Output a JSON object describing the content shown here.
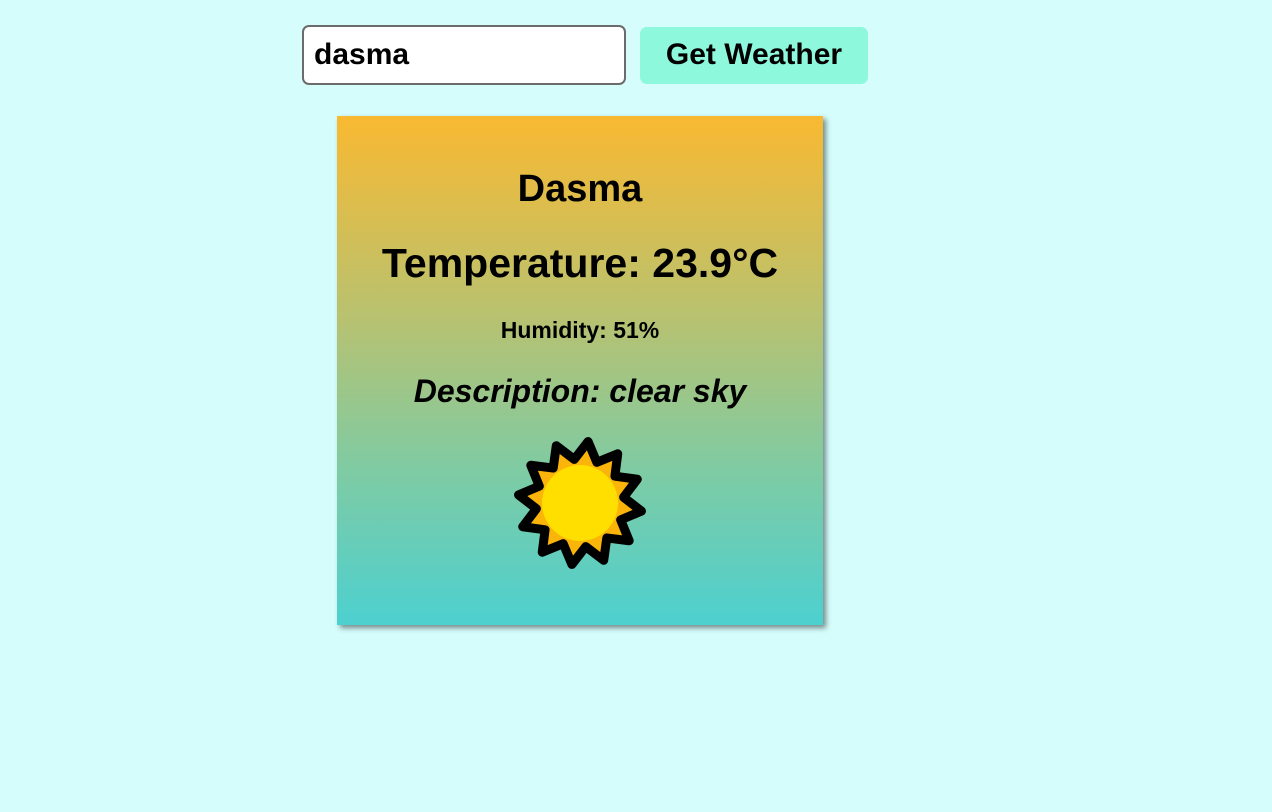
{
  "search": {
    "value": "dasma",
    "button_label": "Get Weather"
  },
  "weather": {
    "city": "Dasma",
    "temperature_text": "Temperature: 23.9°C",
    "humidity_text": "Humidity: 51%",
    "description_text": "Description: clear sky",
    "icon": "sun-icon"
  },
  "colors": {
    "background": "#d4fdfb",
    "button": "#8ef8dc",
    "card_gradient_top": "#f9b931",
    "card_gradient_bottom": "#4dd0d0",
    "sun_rays": "#fbb40a",
    "sun_core": "#ffdf00"
  }
}
